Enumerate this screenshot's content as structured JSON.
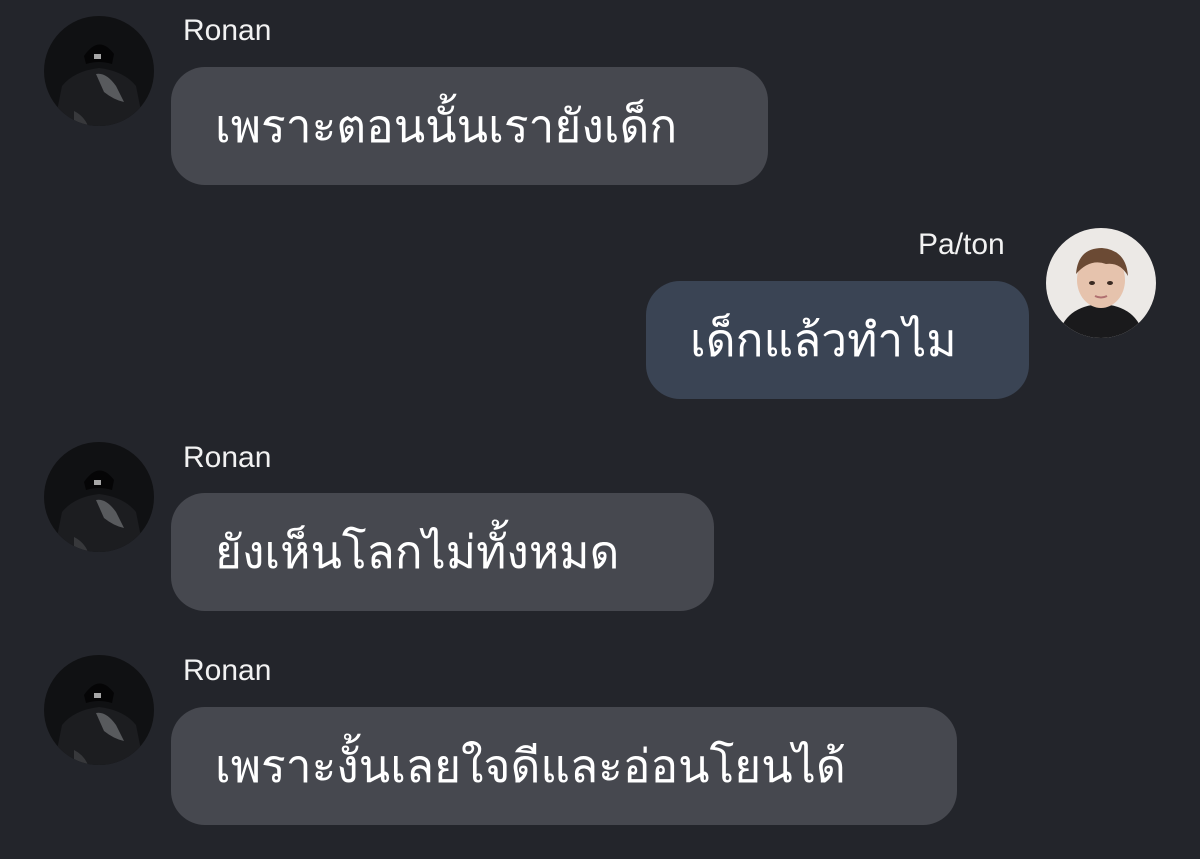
{
  "messages": [
    {
      "sender": "Ronan",
      "direction": "incoming",
      "text": "เพราะตอนนั้นเรายังเด็ก",
      "avatar_icon": "dark-hooded-profile-photo"
    },
    {
      "sender": "Pa/ton",
      "direction": "outgoing",
      "text": "เด็กแล้วทำไม",
      "avatar_icon": "smiling-person-profile-photo"
    },
    {
      "sender": "Ronan",
      "direction": "incoming",
      "text": "ยังเห็นโลกไม่ทั้งหมด",
      "avatar_icon": "dark-hooded-profile-photo"
    },
    {
      "sender": "Ronan",
      "direction": "incoming",
      "text": "เพราะงั้นเลยใจดีและอ่อนโยนได้",
      "avatar_icon": "dark-hooded-profile-photo"
    }
  ],
  "colors": {
    "background": "#23252b",
    "incoming_bubble": "#46484f",
    "outgoing_bubble": "#3a4454",
    "text": "#ffffff"
  }
}
